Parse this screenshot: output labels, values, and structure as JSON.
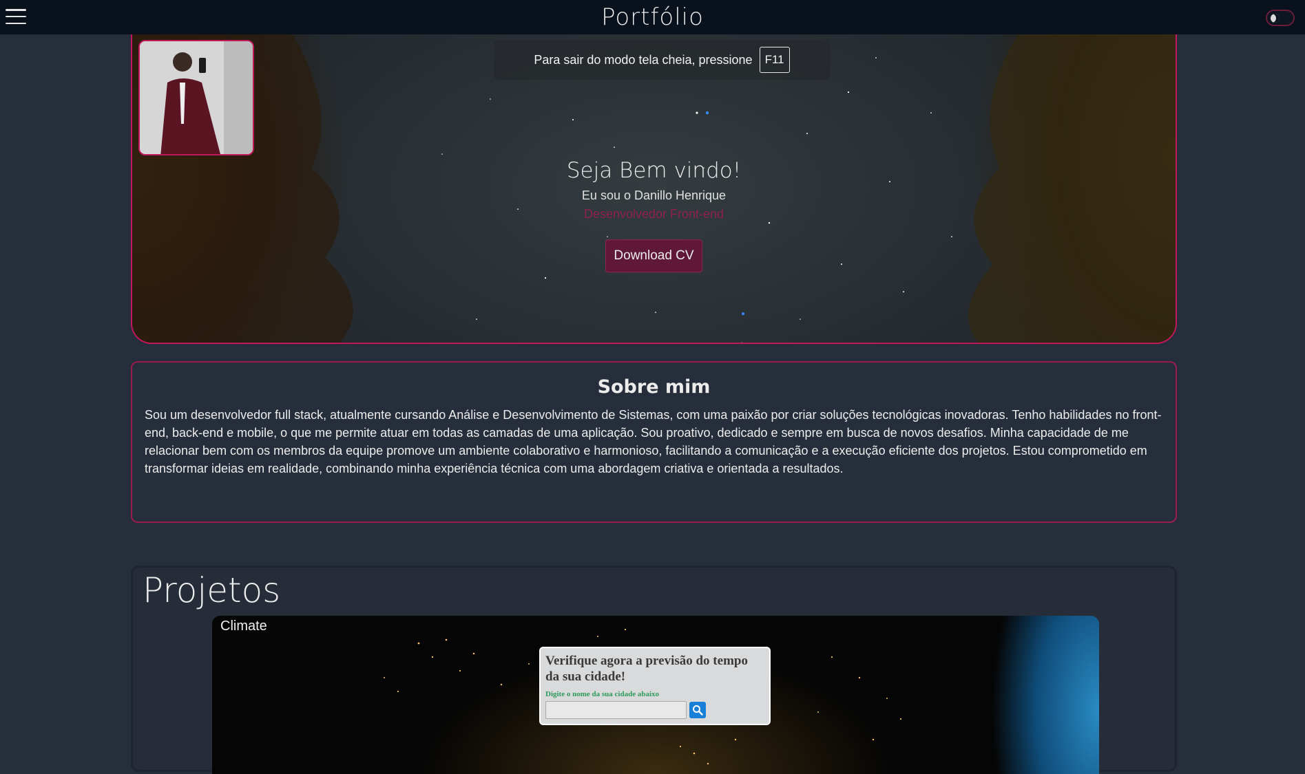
{
  "header": {
    "title": "Portfólio",
    "menu_icon": "hamburger-menu-icon",
    "theme_toggle_icon": "moon-icon"
  },
  "hero": {
    "fullscreen_notice": {
      "text": "Para sair do modo tela cheia, pressione",
      "key": "F11"
    },
    "greeting": "Seja Bem vindo!",
    "name_line": "Eu sou o Danillo Henrique",
    "role": "Desenvolvedor Front-end",
    "download_button": "Download CV"
  },
  "about": {
    "title": "Sobre mim",
    "text": "Sou um desenvolvedor full stack, atualmente cursando Análise e Desenvolvimento de Sistemas, com uma paixão por criar soluções tecnológicas inovadoras. Tenho habilidades no front-end, back-end e mobile, o que me permite atuar em todas as camadas de uma aplicação. Sou proativo, dedicado e sempre em busca de novos desafios. Minha capacidade de me relacionar bem com os membros da equipe promove um ambiente colaborativo e harmonioso, facilitando a comunicação e a execução eficiente dos projetos. Estou comprometido em transformar ideias em realidade, combinando minha experiência técnica com uma abordagem criativa e orientada a resultados."
  },
  "projects": {
    "title": "Projetos",
    "items": [
      {
        "label": "Climate",
        "widget": {
          "title": "Verifique agora a previsão do tempo da sua cidade!",
          "hint": "Digite o nome da sua cidade abaixo",
          "input_value": "",
          "search_icon": "search-icon"
        }
      }
    ]
  },
  "colors": {
    "accent": "#c2185b",
    "topbar": "#09111d",
    "background": "#272e3b",
    "button": "#5f1838"
  }
}
